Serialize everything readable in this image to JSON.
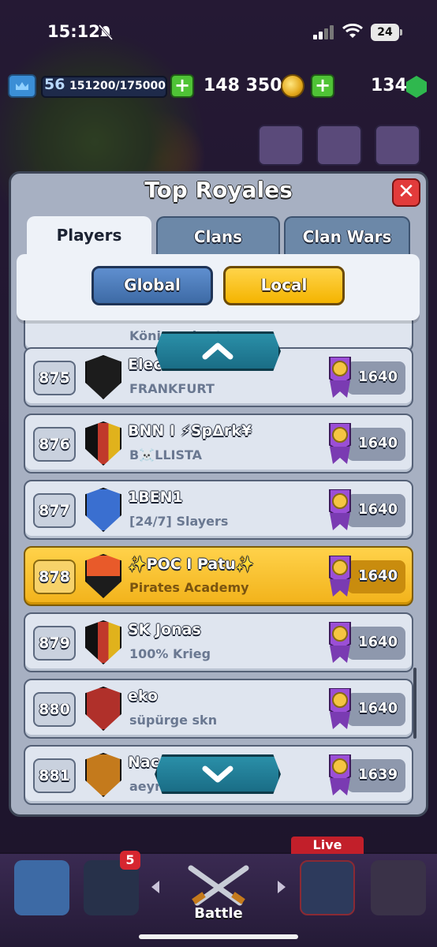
{
  "status_bar": {
    "time": "15:12",
    "battery": "24"
  },
  "resources": {
    "level": "56",
    "xp": "151200/175000",
    "gold": "148 350",
    "gems": "134"
  },
  "panel": {
    "title": "Top Royales",
    "tabs": [
      {
        "label": "Players"
      },
      {
        "label": "Clans"
      },
      {
        "label": "Clan Wars"
      }
    ],
    "filters": {
      "global": "Global",
      "local": "Local"
    },
    "partial_row_clan": "Königsrekruten"
  },
  "leaderboard": [
    {
      "rank": "875",
      "name": "Elec",
      "clan": "FRANKFURT",
      "trophies": "1640",
      "badge_color": "#c0392b"
    },
    {
      "rank": "876",
      "name": "BNN I ⚡SpΔrk¥",
      "clan": "B☠️LLISTA",
      "trophies": "1640",
      "badge_color": "#e0b21c"
    },
    {
      "rank": "877",
      "name": "1BEN1",
      "clan": "[24/7] Slayers",
      "trophies": "1640",
      "badge_color": "#3a6fd0"
    },
    {
      "rank": "878",
      "name": "✨POC I Patu✨",
      "clan": "Pirates Academy",
      "trophies": "1640",
      "badge_color": "#b33a2a",
      "is_me": true
    },
    {
      "rank": "879",
      "name": "SK Jonas",
      "clan": "100% Krieg",
      "trophies": "1640",
      "badge_color": "#8e2d86"
    },
    {
      "rank": "880",
      "name": "eko",
      "clan": "süpürge skn",
      "trophies": "1640",
      "badge_color": "#c0392b"
    },
    {
      "rank": "881",
      "name": "Nac",
      "clan": "aeyr",
      "trophies": "1639",
      "badge_color": "#c47a1c"
    }
  ],
  "bottom_nav": {
    "battle_label": "Battle",
    "live_label": "Live",
    "cards_badge": "5"
  },
  "colors": {
    "panel": "#a7b0c2",
    "row": "#dfe5ef",
    "highlight": "#f2b21a",
    "accent_blue": "#3d6aa5",
    "accent_yellow": "#f4b400"
  }
}
